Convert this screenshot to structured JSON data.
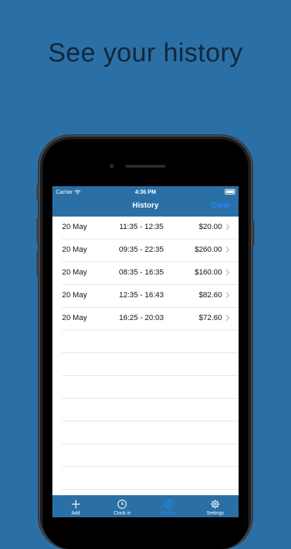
{
  "headline": "See your history",
  "status_bar": {
    "carrier": "Carrier",
    "time": "4:36 PM"
  },
  "nav": {
    "title": "History",
    "action": "Clear"
  },
  "entries": [
    {
      "date": "20 May",
      "time_range": "11:35 - 12:35",
      "amount": "$20.00"
    },
    {
      "date": "20 May",
      "time_range": "09:35 - 22:35",
      "amount": "$260.00"
    },
    {
      "date": "20 May",
      "time_range": "08:35 - 16:35",
      "amount": "$160.00"
    },
    {
      "date": "20 May",
      "time_range": "12:35 - 16:43",
      "amount": "$82.60"
    },
    {
      "date": "20 May",
      "time_range": "16:25 - 20:03",
      "amount": "$72.60"
    }
  ],
  "tabs": [
    {
      "label": "Add",
      "icon": "plus-icon"
    },
    {
      "label": "Clock in",
      "icon": "clock-icon"
    },
    {
      "label": "History",
      "icon": "history-icon",
      "active": true
    },
    {
      "label": "Settings",
      "icon": "gear-icon"
    }
  ],
  "colors": {
    "background": "#2a70a6",
    "accent": "#1e8cff",
    "headline": "#14263a"
  }
}
